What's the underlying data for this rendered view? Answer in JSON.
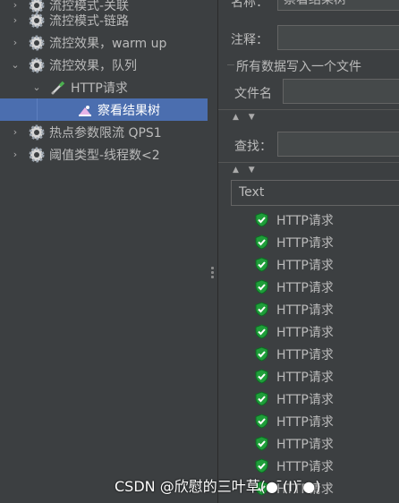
{
  "tree": {
    "items": [
      {
        "label": "流控模式-关联",
        "arrow": "›",
        "expanded": false
      },
      {
        "label": "流控模式-链路",
        "arrow": "›",
        "expanded": false
      },
      {
        "label": "流控效果，warm up",
        "arrow": "›",
        "expanded": false
      },
      {
        "label": "流控效果，队列",
        "arrow": "⌄",
        "expanded": true
      },
      {
        "label": "HTTP请求",
        "arrow": "⌄",
        "expanded": true
      },
      {
        "label": "察看结果树",
        "selected": true
      },
      {
        "label": "热点参数限流 QPS1",
        "arrow": "›",
        "expanded": false
      },
      {
        "label": "阈值类型-线程数<2",
        "arrow": "›",
        "expanded": false
      }
    ]
  },
  "form": {
    "name_label": "名称：",
    "name_value": "察看结果树",
    "comment_label": "注释：",
    "group_title": "所有数据写入一个文件",
    "filename_label": "文件名",
    "search_label": "查找：",
    "collapse_arrows": "▲ ▼",
    "renderer_value": "Text"
  },
  "results": {
    "items": [
      "HTTP请求",
      "HTTP请求",
      "HTTP请求",
      "HTTP请求",
      "HTTP请求",
      "HTTP请求",
      "HTTP请求",
      "HTTP请求",
      "HTTP请求",
      "HTTP请求",
      "HTTP请求",
      "HTTP请求",
      "HTTP请求"
    ]
  },
  "watermark": "CSDN @欣慰的三叶草(● ̄(I) ̄●)",
  "colors": {
    "background": "#3c3f41",
    "selection": "#4b6eaf",
    "success_green": "#1f9e3a"
  },
  "icons": {
    "test_element": "gear-icon",
    "sampler": "pipette-icon",
    "listener": "result-tree-icon",
    "success": "green-shield-check-icon"
  }
}
